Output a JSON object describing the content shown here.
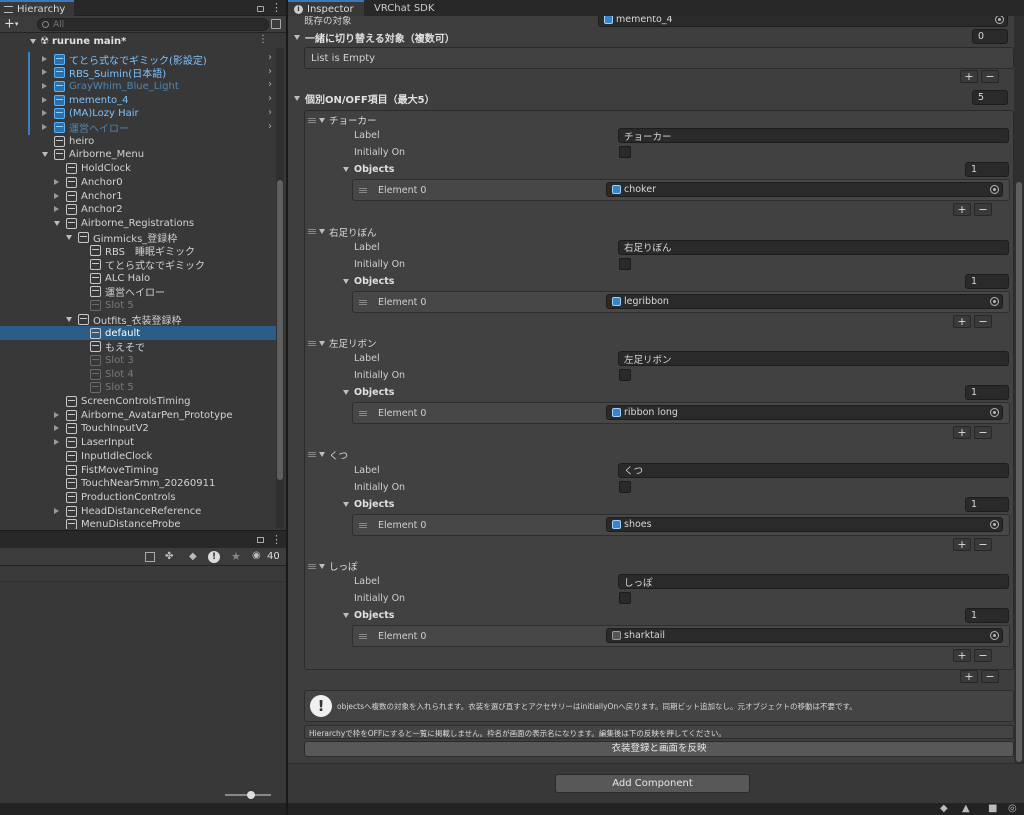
{
  "hierarchy": {
    "tab_label": "Hierarchy",
    "search_placeholder": "All",
    "scene_name": "rurune main*",
    "items": [
      {
        "label": "てとら式なでギミック(影設定)",
        "color": "blue-link"
      },
      {
        "label": "RBS_Suimin(日本語)",
        "color": "blue-link"
      },
      {
        "label": "GrayWhim_Blue_Light",
        "color": "blue-dim"
      },
      {
        "label": "memento_4",
        "color": "blue-link"
      },
      {
        "label": "(MA)Lozy Hair",
        "color": "blue-link"
      },
      {
        "label": "運営ヘイロー",
        "color": "blue-dim"
      },
      {
        "label": "heiro"
      },
      {
        "label": "Airborne_Menu"
      },
      {
        "label": "HoldClock"
      },
      {
        "label": "Anchor0"
      },
      {
        "label": "Anchor1"
      },
      {
        "label": "Anchor2"
      },
      {
        "label": "Airborne_Registrations"
      },
      {
        "label": "Gimmicks_登録枠"
      },
      {
        "label": "RBS　睡眠ギミック"
      },
      {
        "label": "てとら式なでギミック"
      },
      {
        "label": "ALC Halo"
      },
      {
        "label": "運営ヘイロー"
      },
      {
        "label": "Slot 5"
      },
      {
        "label": "Outfits_衣装登録枠"
      },
      {
        "label": "default"
      },
      {
        "label": "もえそで"
      },
      {
        "label": "Slot 3"
      },
      {
        "label": "Slot 4"
      },
      {
        "label": "Slot 5"
      },
      {
        "label": "ScreenControlsTiming"
      },
      {
        "label": "Airborne_AvatarPen_Prototype"
      },
      {
        "label": "TouchInputV2"
      },
      {
        "label": "LaserInput"
      },
      {
        "label": "InputIdleClock"
      },
      {
        "label": "FistMoveTiming"
      },
      {
        "label": "TouchNear5mm_20260911"
      },
      {
        "label": "ProductionControls"
      },
      {
        "label": "HeadDistanceReference"
      },
      {
        "label": "MenuDistanceProbe"
      }
    ]
  },
  "bottom_panel": {
    "hidden_count": "40"
  },
  "inspector": {
    "tab_inspector": "Inspector",
    "tab_vrchat": "VRChat SDK",
    "existing_target_label": "既存の対象",
    "existing_target_value": "memento_4",
    "switch_section": {
      "label": "一緒に切り替える対象（複数可）",
      "count": "0",
      "empty_text": "List is Empty"
    },
    "individual_section": {
      "label": "個別ON/OFF項目（最大5）",
      "count": "5"
    },
    "field_label": "Label",
    "field_initially_on": "Initially On",
    "field_objects": "Objects",
    "element_label": "Element 0",
    "entries": [
      {
        "title": "チョーカー",
        "label_value": "チョーカー",
        "objects_count": "1",
        "element_value": "choker"
      },
      {
        "title": "右足りぼん",
        "label_value": "右足りぼん",
        "objects_count": "1",
        "element_value": "legribbon"
      },
      {
        "title": "左足リボン",
        "label_value": "左足リボン",
        "objects_count": "1",
        "element_value": "ribbon long"
      },
      {
        "title": "くつ",
        "label_value": "くつ",
        "objects_count": "1",
        "element_value": "shoes"
      },
      {
        "title": "しっぽ",
        "label_value": "しっぽ",
        "objects_count": "1",
        "element_value": "sharktail"
      }
    ],
    "help_text": "objectsへ複数の対象を入れられます。衣装を選び直すとアクセサリーはinitiallyOnへ戻ります。同期ビット追加なし。元オブジェクトの移動は不要です。",
    "note_text": "Hierarchyで枠をOFFにすると一覧に掲載しません。枠名が画面の表示名になります。編集後は下の反映を押してください。",
    "apply_button": "衣装登録と画面を反映",
    "add_component": "Add Component"
  },
  "colors": {
    "panel_bg": "#383838",
    "inspector_bg": "#3e3e3e",
    "selection": "#2c5d87",
    "prefab_blue": "#7cc3ff"
  }
}
